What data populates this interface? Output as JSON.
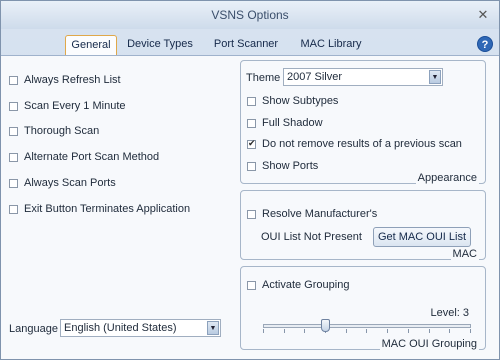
{
  "window": {
    "title": "VSNS Options"
  },
  "tabs": [
    {
      "label": "General",
      "active": true
    },
    {
      "label": "Device Types"
    },
    {
      "label": "Port Scanner"
    },
    {
      "label": "MAC Library"
    }
  ],
  "general": {
    "options": [
      {
        "label": "Always Refresh List",
        "checked": false
      },
      {
        "label": "Scan Every 1 Minute",
        "checked": false
      },
      {
        "label": "Thorough Scan",
        "checked": false
      },
      {
        "label": "Alternate Port Scan Method",
        "checked": false
      },
      {
        "label": "Always Scan Ports",
        "checked": false
      },
      {
        "label": "Exit Button Terminates Application",
        "checked": false
      }
    ],
    "language_label": "Language",
    "language_value": "English (United States)"
  },
  "appearance": {
    "caption": "Appearance",
    "theme_label": "Theme",
    "theme_value": "2007 Silver",
    "options": [
      {
        "label": "Show Subtypes",
        "checked": false
      },
      {
        "label": "Full Shadow",
        "checked": false
      },
      {
        "label": "Do not remove results of a previous scan",
        "checked": true
      },
      {
        "label": "Show Ports",
        "checked": false
      }
    ]
  },
  "mac": {
    "caption": "MAC",
    "resolve_label": "Resolve Manufacturer's",
    "resolve_checked": false,
    "oui_status": "OUI List Not Present",
    "get_button": "Get MAC OUI List"
  },
  "grouping": {
    "caption": "MAC OUI Grouping",
    "activate_label": "Activate Grouping",
    "activate_checked": false,
    "level_text": "Level: 3",
    "level": 3,
    "level_max": 10
  },
  "icons": {
    "close": "close-icon",
    "help": "help-icon",
    "dropdown": "chevron-down-icon"
  }
}
